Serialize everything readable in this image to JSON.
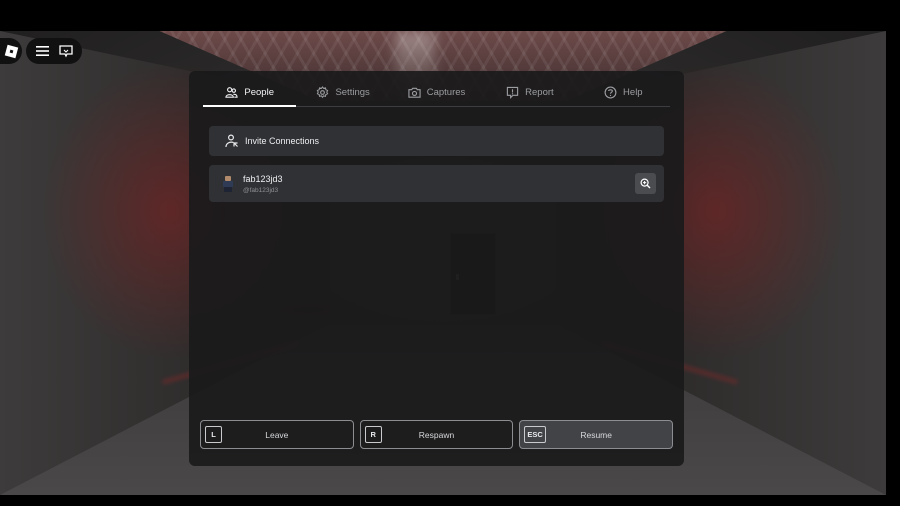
{
  "tabs": [
    {
      "label": "People",
      "icon": "people-icon",
      "active": true
    },
    {
      "label": "Settings",
      "icon": "gear-icon",
      "active": false
    },
    {
      "label": "Captures",
      "icon": "camera-icon",
      "active": false
    },
    {
      "label": "Report",
      "icon": "report-flag-icon",
      "active": false
    },
    {
      "label": "Help",
      "icon": "help-icon",
      "active": false
    }
  ],
  "invite": {
    "label": "Invite Connections",
    "icon": "invite-person-icon"
  },
  "player": {
    "display_name": "fab123jd3",
    "username": "@fab123jd3",
    "action_icon": "inspect-zoom-icon"
  },
  "buttons": [
    {
      "key": "L",
      "label": "Leave"
    },
    {
      "key": "R",
      "label": "Respawn"
    },
    {
      "key": "ESC",
      "label": "Resume"
    }
  ],
  "topbar": {
    "logo": "roblox-logo-icon",
    "menu_icon": "hamburger-menu-icon",
    "chat_icon": "chat-icon"
  },
  "colors": {
    "panel_bg": "#1a1a1b",
    "row_bg": "#343538",
    "active_tab": "#ffffff",
    "scene_glow": "#962020"
  }
}
